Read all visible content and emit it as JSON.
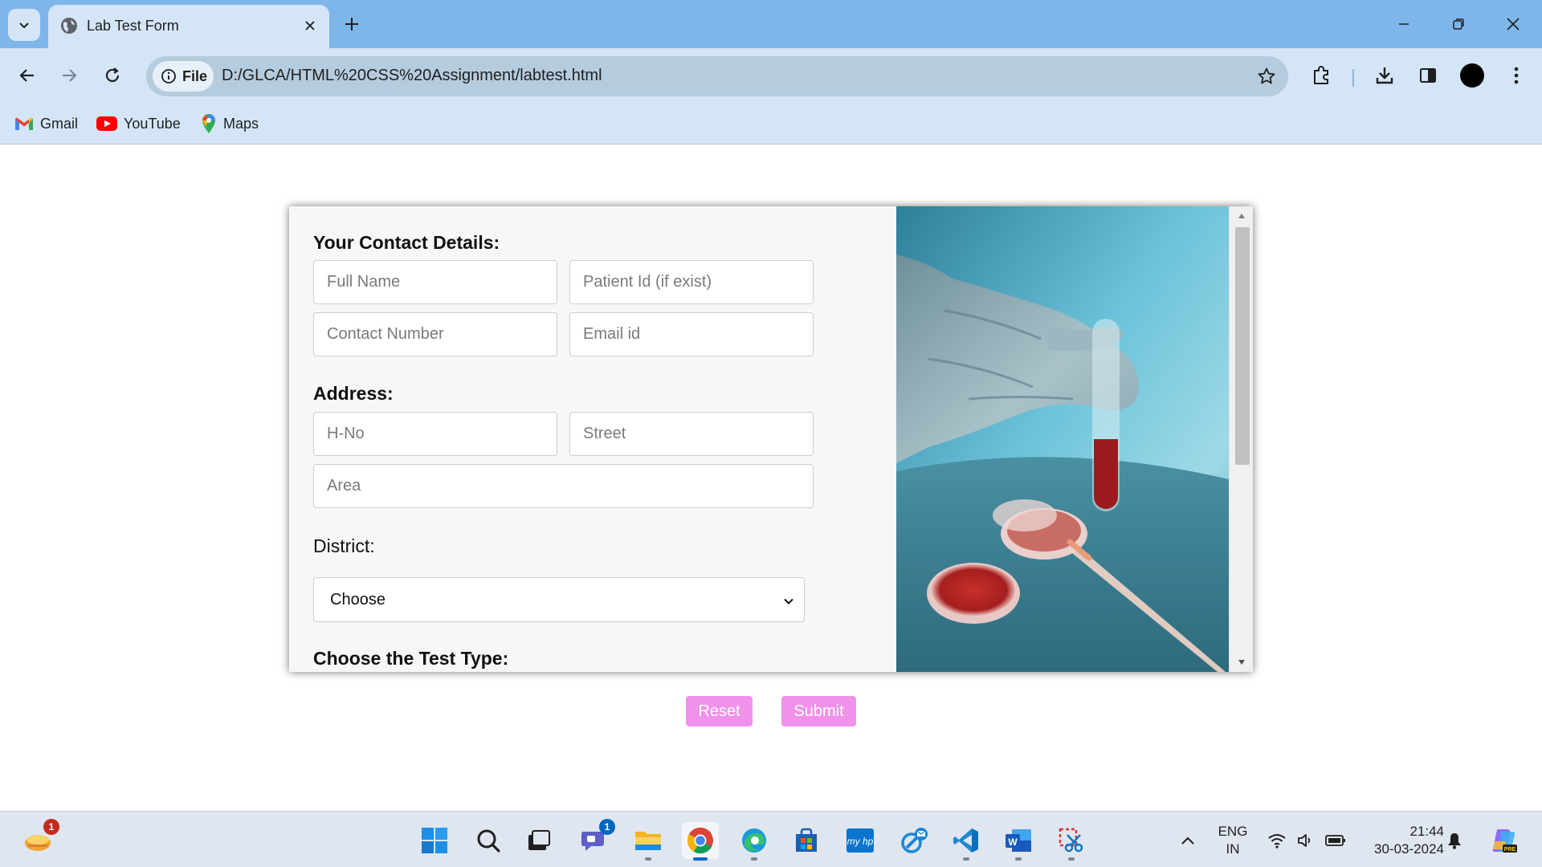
{
  "browser": {
    "tab_title": "Lab Test Form",
    "omnibox_chip": "File",
    "url": "D:/GLCA/HTML%20CSS%20Assignment/labtest.html",
    "bookmarks": [
      {
        "label": "Gmail",
        "icon": "gmail-icon"
      },
      {
        "label": "YouTube",
        "icon": "youtube-icon"
      },
      {
        "label": "Maps",
        "icon": "maps-icon"
      }
    ]
  },
  "form": {
    "contact_title": "Your Contact Details:",
    "full_name_placeholder": "Full Name",
    "patient_id_placeholder": "Patient Id (if exist)",
    "contact_number_placeholder": "Contact Number",
    "email_placeholder": "Email id",
    "address_title": "Address:",
    "hno_placeholder": "H-No",
    "street_placeholder": "Street",
    "area_placeholder": "Area",
    "district_label": "District:",
    "district_selected": "Choose",
    "test_type_title": "Choose the Test Type:",
    "reset_label": "Reset",
    "submit_label": "Submit"
  },
  "colors": {
    "accent_button": "#f092ea",
    "tab_bar": "#7fb6ea",
    "toolbar": "#d3e5f7"
  },
  "taskbar": {
    "widgets_badge": "1",
    "teams_badge": "1",
    "lang_line1": "ENG",
    "lang_line2": "IN",
    "time": "21:44",
    "date": "30-03-2024"
  }
}
